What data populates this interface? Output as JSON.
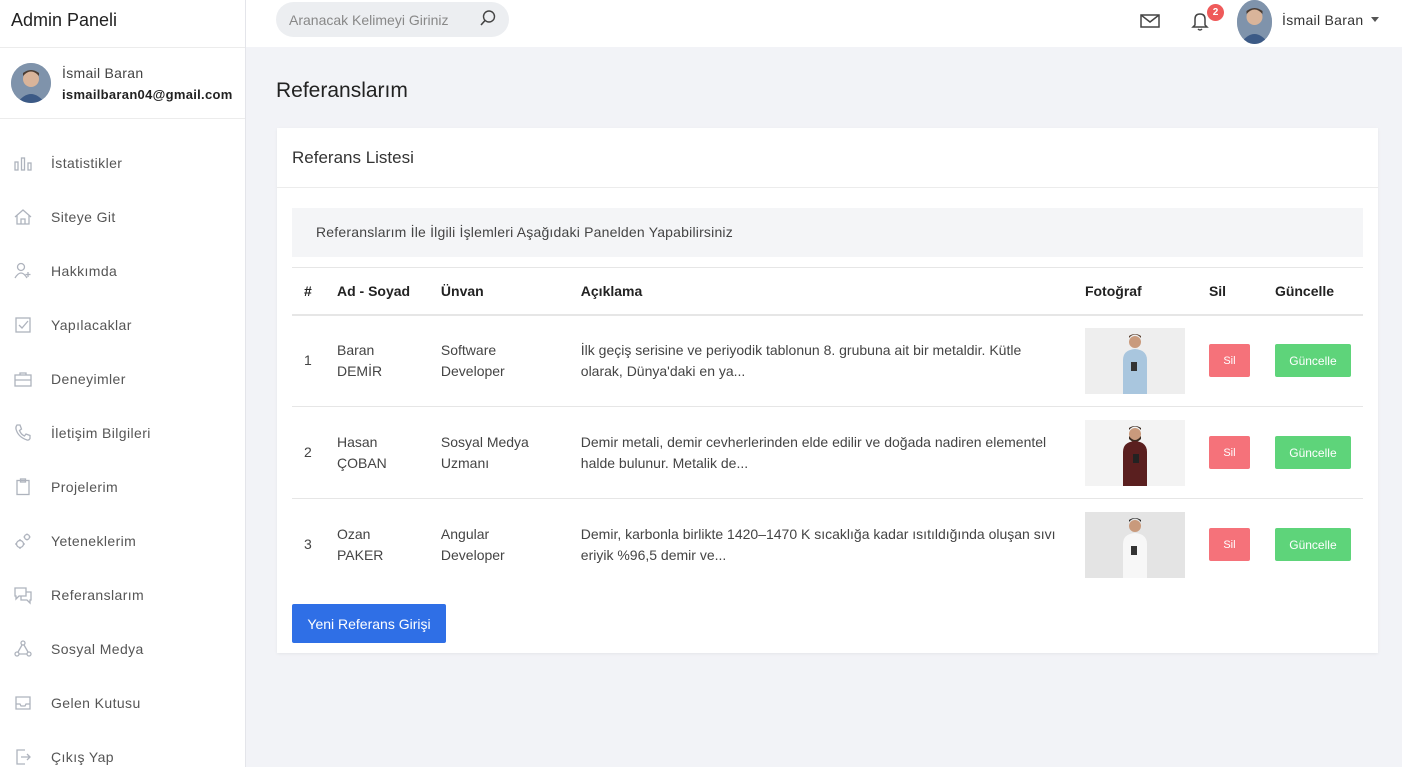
{
  "sidebar": {
    "brand": "Admin Paneli",
    "profile": {
      "name": "İsmail Baran",
      "email": "ismailbaran04@gmail.com"
    },
    "items": [
      {
        "label": "İstatistikler",
        "icon": "chart-icon"
      },
      {
        "label": "Siteye Git",
        "icon": "home-icon"
      },
      {
        "label": "Hakkımda",
        "icon": "user-icon"
      },
      {
        "label": "Yapılacaklar",
        "icon": "checkbox-icon"
      },
      {
        "label": "Deneyimler",
        "icon": "briefcase-icon"
      },
      {
        "label": "İletişim Bilgileri",
        "icon": "phone-icon"
      },
      {
        "label": "Projelerim",
        "icon": "clipboard-icon"
      },
      {
        "label": "Yeteneklerim",
        "icon": "gears-icon"
      },
      {
        "label": "Referanslarım",
        "icon": "chat-icon"
      },
      {
        "label": "Sosyal Medya",
        "icon": "share-icon"
      },
      {
        "label": "Gelen Kutusu",
        "icon": "inbox-icon"
      },
      {
        "label": "Çıkış Yap",
        "icon": "logout-icon"
      }
    ]
  },
  "header": {
    "search_placeholder": "Aranacak Kelimeyi Giriniz",
    "notification_count": "2",
    "user_name": "İsmail Baran"
  },
  "main": {
    "page_title": "Referanslarım",
    "card_title": "Referans Listesi",
    "info_text": "Referanslarım İle İlgili İşlemleri Aşağıdaki Panelden Yapabilirsiniz",
    "columns": [
      "#",
      "Ad - Soyad",
      "Ünvan",
      "Açıklama",
      "Fotoğraf",
      "Sil",
      "Güncelle"
    ],
    "rows": [
      {
        "no": "1",
        "name": "Baran DEMİR",
        "title": "Software Developer",
        "desc": "İlk geçiş serisine ve periyodik tablonun 8. grubuna ait bir metaldir. Kütle olarak, Dünya'daki en ya...",
        "sil": "Sil",
        "guncelle": "Güncelle"
      },
      {
        "no": "2",
        "name": "Hasan ÇOBAN",
        "title": "Sosyal Medya Uzmanı",
        "desc": "Demir metali, demir cevherlerinden elde edilir ve doğada nadiren elementel halde bulunur. Metalik de...",
        "sil": "Sil",
        "guncelle": "Güncelle"
      },
      {
        "no": "3",
        "name": "Ozan PAKER",
        "title": "Angular Developer",
        "desc": "Demir, karbonla birlikte 1420–1470 K sıcaklığa kadar ısıtıldığında oluşan sıvı eriyik %96,5 demir ve...",
        "sil": "Sil",
        "guncelle": "Güncelle"
      }
    ],
    "new_button": "Yeni Referans Girişi"
  },
  "colors": {
    "accent": "#2f6fe6",
    "delete": "#f5727a",
    "update": "#5ed47a",
    "badge": "#ef5a5a"
  }
}
